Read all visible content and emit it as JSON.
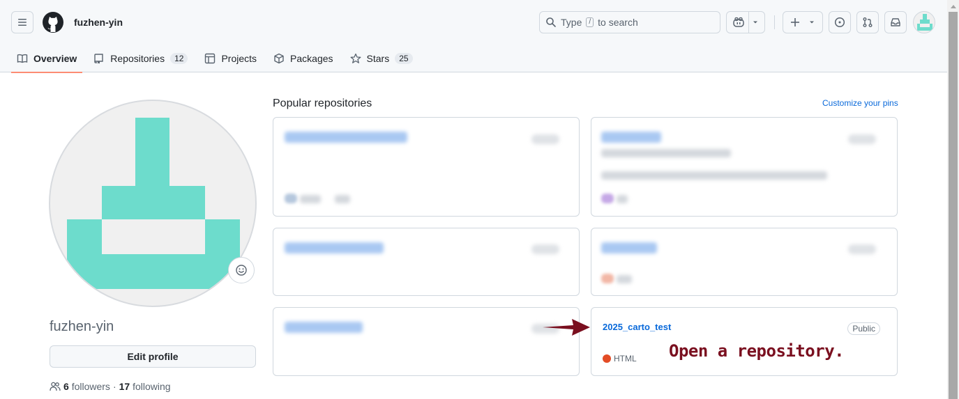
{
  "header": {
    "username": "fuzhen-yin",
    "search": {
      "before": "Type",
      "key": "/",
      "after": "to search"
    }
  },
  "tabs": [
    {
      "label": "Overview",
      "count": null,
      "icon": "book-icon"
    },
    {
      "label": "Repositories",
      "count": "12",
      "icon": "repo-icon"
    },
    {
      "label": "Projects",
      "count": null,
      "icon": "table-icon"
    },
    {
      "label": "Packages",
      "count": null,
      "icon": "package-icon"
    },
    {
      "label": "Stars",
      "count": "25",
      "icon": "star-icon"
    }
  ],
  "profile": {
    "name": "fuzhen-yin",
    "edit_label": "Edit profile",
    "followers_count": "6",
    "followers_label": "followers",
    "separator": "·",
    "following_count": "17",
    "following_label": "following"
  },
  "popular": {
    "title": "Popular repositories",
    "customize_label": "Customize your pins",
    "visible_repo": {
      "name": "2025_carto_test",
      "visibility": "Public",
      "language": "HTML",
      "language_color": "#e34c26"
    }
  },
  "annotation": {
    "text": "Open a repository.",
    "color": "#7a0f1f"
  },
  "colors": {
    "accent_link": "#0969da",
    "tab_underline": "#fd8c73",
    "avatar_teal": "#6ddccc"
  }
}
